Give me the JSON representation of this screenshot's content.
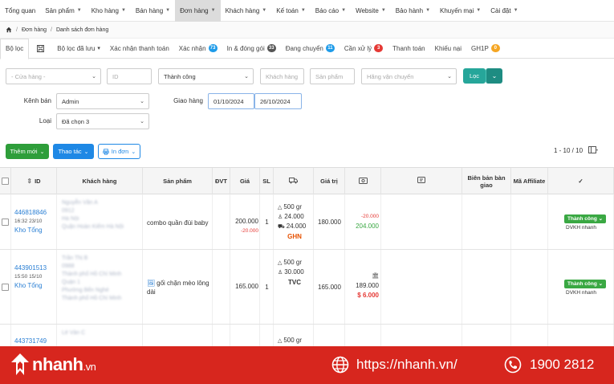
{
  "nav": {
    "items": [
      {
        "label": "Tổng quan",
        "has_caret": false
      },
      {
        "label": "Sản phẩm",
        "has_caret": true
      },
      {
        "label": "Kho hàng",
        "has_caret": true
      },
      {
        "label": "Bán hàng",
        "has_caret": true
      },
      {
        "label": "Đơn hàng",
        "has_caret": true,
        "active": true
      },
      {
        "label": "Khách hàng",
        "has_caret": true
      },
      {
        "label": "Kế toán",
        "has_caret": true
      },
      {
        "label": "Báo cáo",
        "has_caret": true
      },
      {
        "label": "Website",
        "has_caret": true
      },
      {
        "label": "Bảo hành",
        "has_caret": true
      },
      {
        "label": "Khuyến mại",
        "has_caret": true
      },
      {
        "label": "Cài đặt",
        "has_caret": true
      }
    ]
  },
  "breadcrumb": {
    "home_icon": "home-icon",
    "level1": "Đơn hàng",
    "level2": "Danh sách đơn hàng"
  },
  "tabs": [
    {
      "label": "Bộ lọc",
      "active": true
    },
    {
      "label": "",
      "icon": "floppy-icon"
    },
    {
      "label": "Bộ lọc đã lưu",
      "caret": true
    },
    {
      "label": "Xác nhận thanh toán"
    },
    {
      "label": "Xác nhận",
      "badge": "73",
      "badge_color": "#1e9be9"
    },
    {
      "label": "In & đóng gói",
      "badge": "33",
      "badge_color": "#555555"
    },
    {
      "label": "Đang chuyển",
      "badge": "11",
      "badge_color": "#1e9be9"
    },
    {
      "label": "Cần xử lý",
      "badge": "3",
      "badge_color": "#e53935"
    },
    {
      "label": "Thanh toán"
    },
    {
      "label": "Khiếu nại"
    },
    {
      "label": "GH1P",
      "badge": "0",
      "badge_color": "#f5a623"
    }
  ],
  "filters": {
    "store_placeholder": "- Cửa hàng -",
    "id_placeholder": "ID",
    "status_value": "Thành công",
    "customer_placeholder": "Khách hàng",
    "product_placeholder": "Sản phẩm",
    "carrier_placeholder": "Hãng vận chuyển",
    "filter_button": "Lọc",
    "channel_label": "Kênh bán",
    "channel_value": "Admin",
    "delivery_label": "Giao hàng",
    "date_from": "01/10/2024",
    "date_to": "26/10/2024",
    "type_label": "Loại",
    "type_value": "Đã chọn 3"
  },
  "toolbar": {
    "add_new": "Thêm mới",
    "actions": "Thao tác",
    "print": "In đơn",
    "pagination": "1 - 10 / 10"
  },
  "table": {
    "headers": [
      "ID",
      "Khách hàng",
      "Sản phẩm",
      "ĐVT",
      "Giá",
      "SL",
      "",
      "Giá trị",
      "",
      "",
      "Biên bản bàn giao",
      "Mã Affiliate",
      "✓"
    ],
    "rows": [
      {
        "id": "446818846",
        "time": "16:32 23/10",
        "warehouse": "Kho Tổng",
        "customer_lines": [
          "Nguyễn Văn A",
          "0912",
          "Hà Nội",
          "Quận Hoàn Kiếm Hà Nội"
        ],
        "product": "combo quần đùi baby",
        "product_has_image": false,
        "price": "200.000",
        "discount": "-20.000",
        "qty": "1",
        "weight": "500 gr",
        "cod": "24.000",
        "ship": "24.000",
        "carrier": "GHN",
        "value": "180.000",
        "total_discount": "-20.000",
        "total": "204.000",
        "bank": false,
        "extra": "",
        "status": "Thành công",
        "staff": "DVKH nhanh"
      },
      {
        "id": "443901513",
        "time": "15:50 15/10",
        "warehouse": "Kho Tổng",
        "customer_lines": [
          "Trần Thị B",
          "0988",
          "Thành phố Hồ Chí Minh",
          "Quận 1",
          "Phường Bến Nghé",
          "Thành phố Hồ Chí Minh"
        ],
        "product": "gối chặn mèo lông dài",
        "product_has_image": true,
        "price": "165.000",
        "discount": "",
        "qty": "1",
        "weight": "500 gr",
        "cod": "30.000",
        "ship": "",
        "carrier": "TVC",
        "value": "165.000",
        "total_discount": "",
        "total": "189.000",
        "bank": true,
        "extra": "6.000",
        "status": "Thành công",
        "staff": "DVKH nhanh"
      },
      {
        "id": "443731749",
        "time": "",
        "warehouse": "",
        "customer_lines": [
          "Lê Văn C"
        ],
        "product": "",
        "product_has_image": false,
        "price": "",
        "discount": "",
        "qty": "",
        "weight": "500 gr",
        "cod": "",
        "ship": "",
        "carrier": "",
        "value": "",
        "total_discount": "",
        "total": "",
        "bank": false,
        "extra": "",
        "status": "",
        "staff": ""
      }
    ]
  },
  "footer": {
    "brand": "nhanh",
    "brand_suffix": ".vn",
    "website": "https://nhanh.vn/",
    "phone": "1900 2812",
    "colors": {
      "bg": "#d7261e"
    }
  }
}
